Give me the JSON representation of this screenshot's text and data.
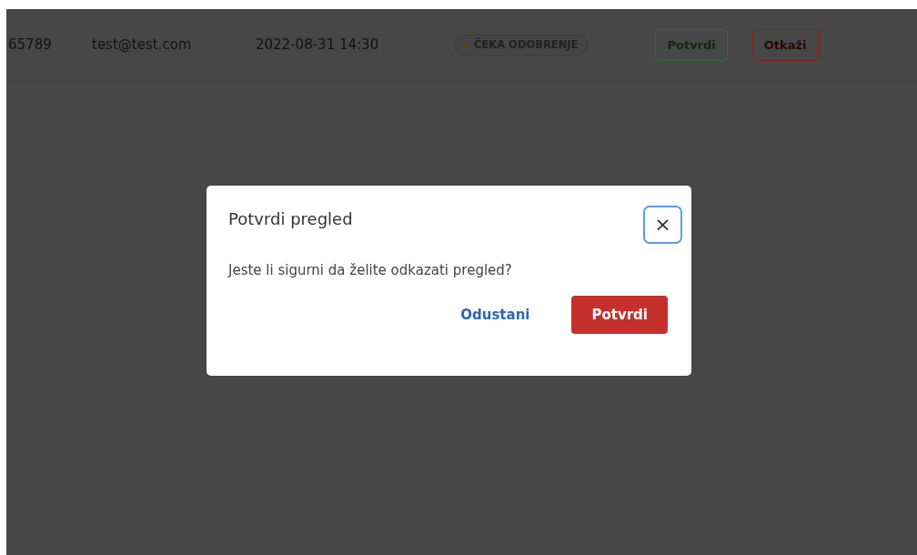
{
  "table_row": {
    "id": "65789",
    "email": "test@test.com",
    "datetime": "2022-08-31 14:30",
    "status": "ČEKA ODOBRENJE",
    "actions": [
      {
        "label": "Potvrdi",
        "kind": "confirm"
      },
      {
        "label": "Otkaži",
        "kind": "cancel"
      }
    ]
  },
  "modal": {
    "title": "Potvrdi pregled",
    "close": "×",
    "message": "Jeste li sigurni da želite odkazati pregled?",
    "buttons": [
      {
        "label": "Odustani",
        "kind": "link"
      },
      {
        "label": "Potvrdi",
        "kind": "danger"
      }
    ]
  }
}
